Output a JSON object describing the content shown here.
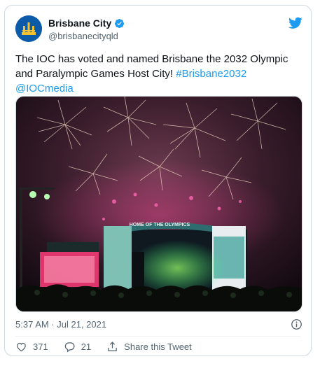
{
  "account": {
    "display_name": "Brisbane City",
    "handle": "@brisbanecityqld",
    "verified": true
  },
  "tweet": {
    "text": "The IOC has voted and named Brisbane the 2032 Olympic and Paralympic Games Host City! ",
    "hashtag": "#Brisbane2032",
    "mention": "@IOCmedia"
  },
  "media": {
    "stage_banner": "HOME OF THE OLYMPICS"
  },
  "meta": {
    "timestamp": "5:37 AM · Jul 21, 2021"
  },
  "actions": {
    "like_count": "371",
    "reply_count": "21",
    "share_label": "Share this Tweet"
  },
  "icons": {
    "brand": "twitter-bird-icon",
    "verified": "verified-badge-icon",
    "info": "info-icon",
    "like": "heart-icon",
    "reply": "reply-bubble-icon",
    "share": "share-icon"
  },
  "colors": {
    "accent": "#1d9bf0",
    "muted": "#536471",
    "border": "#cfd9de"
  }
}
